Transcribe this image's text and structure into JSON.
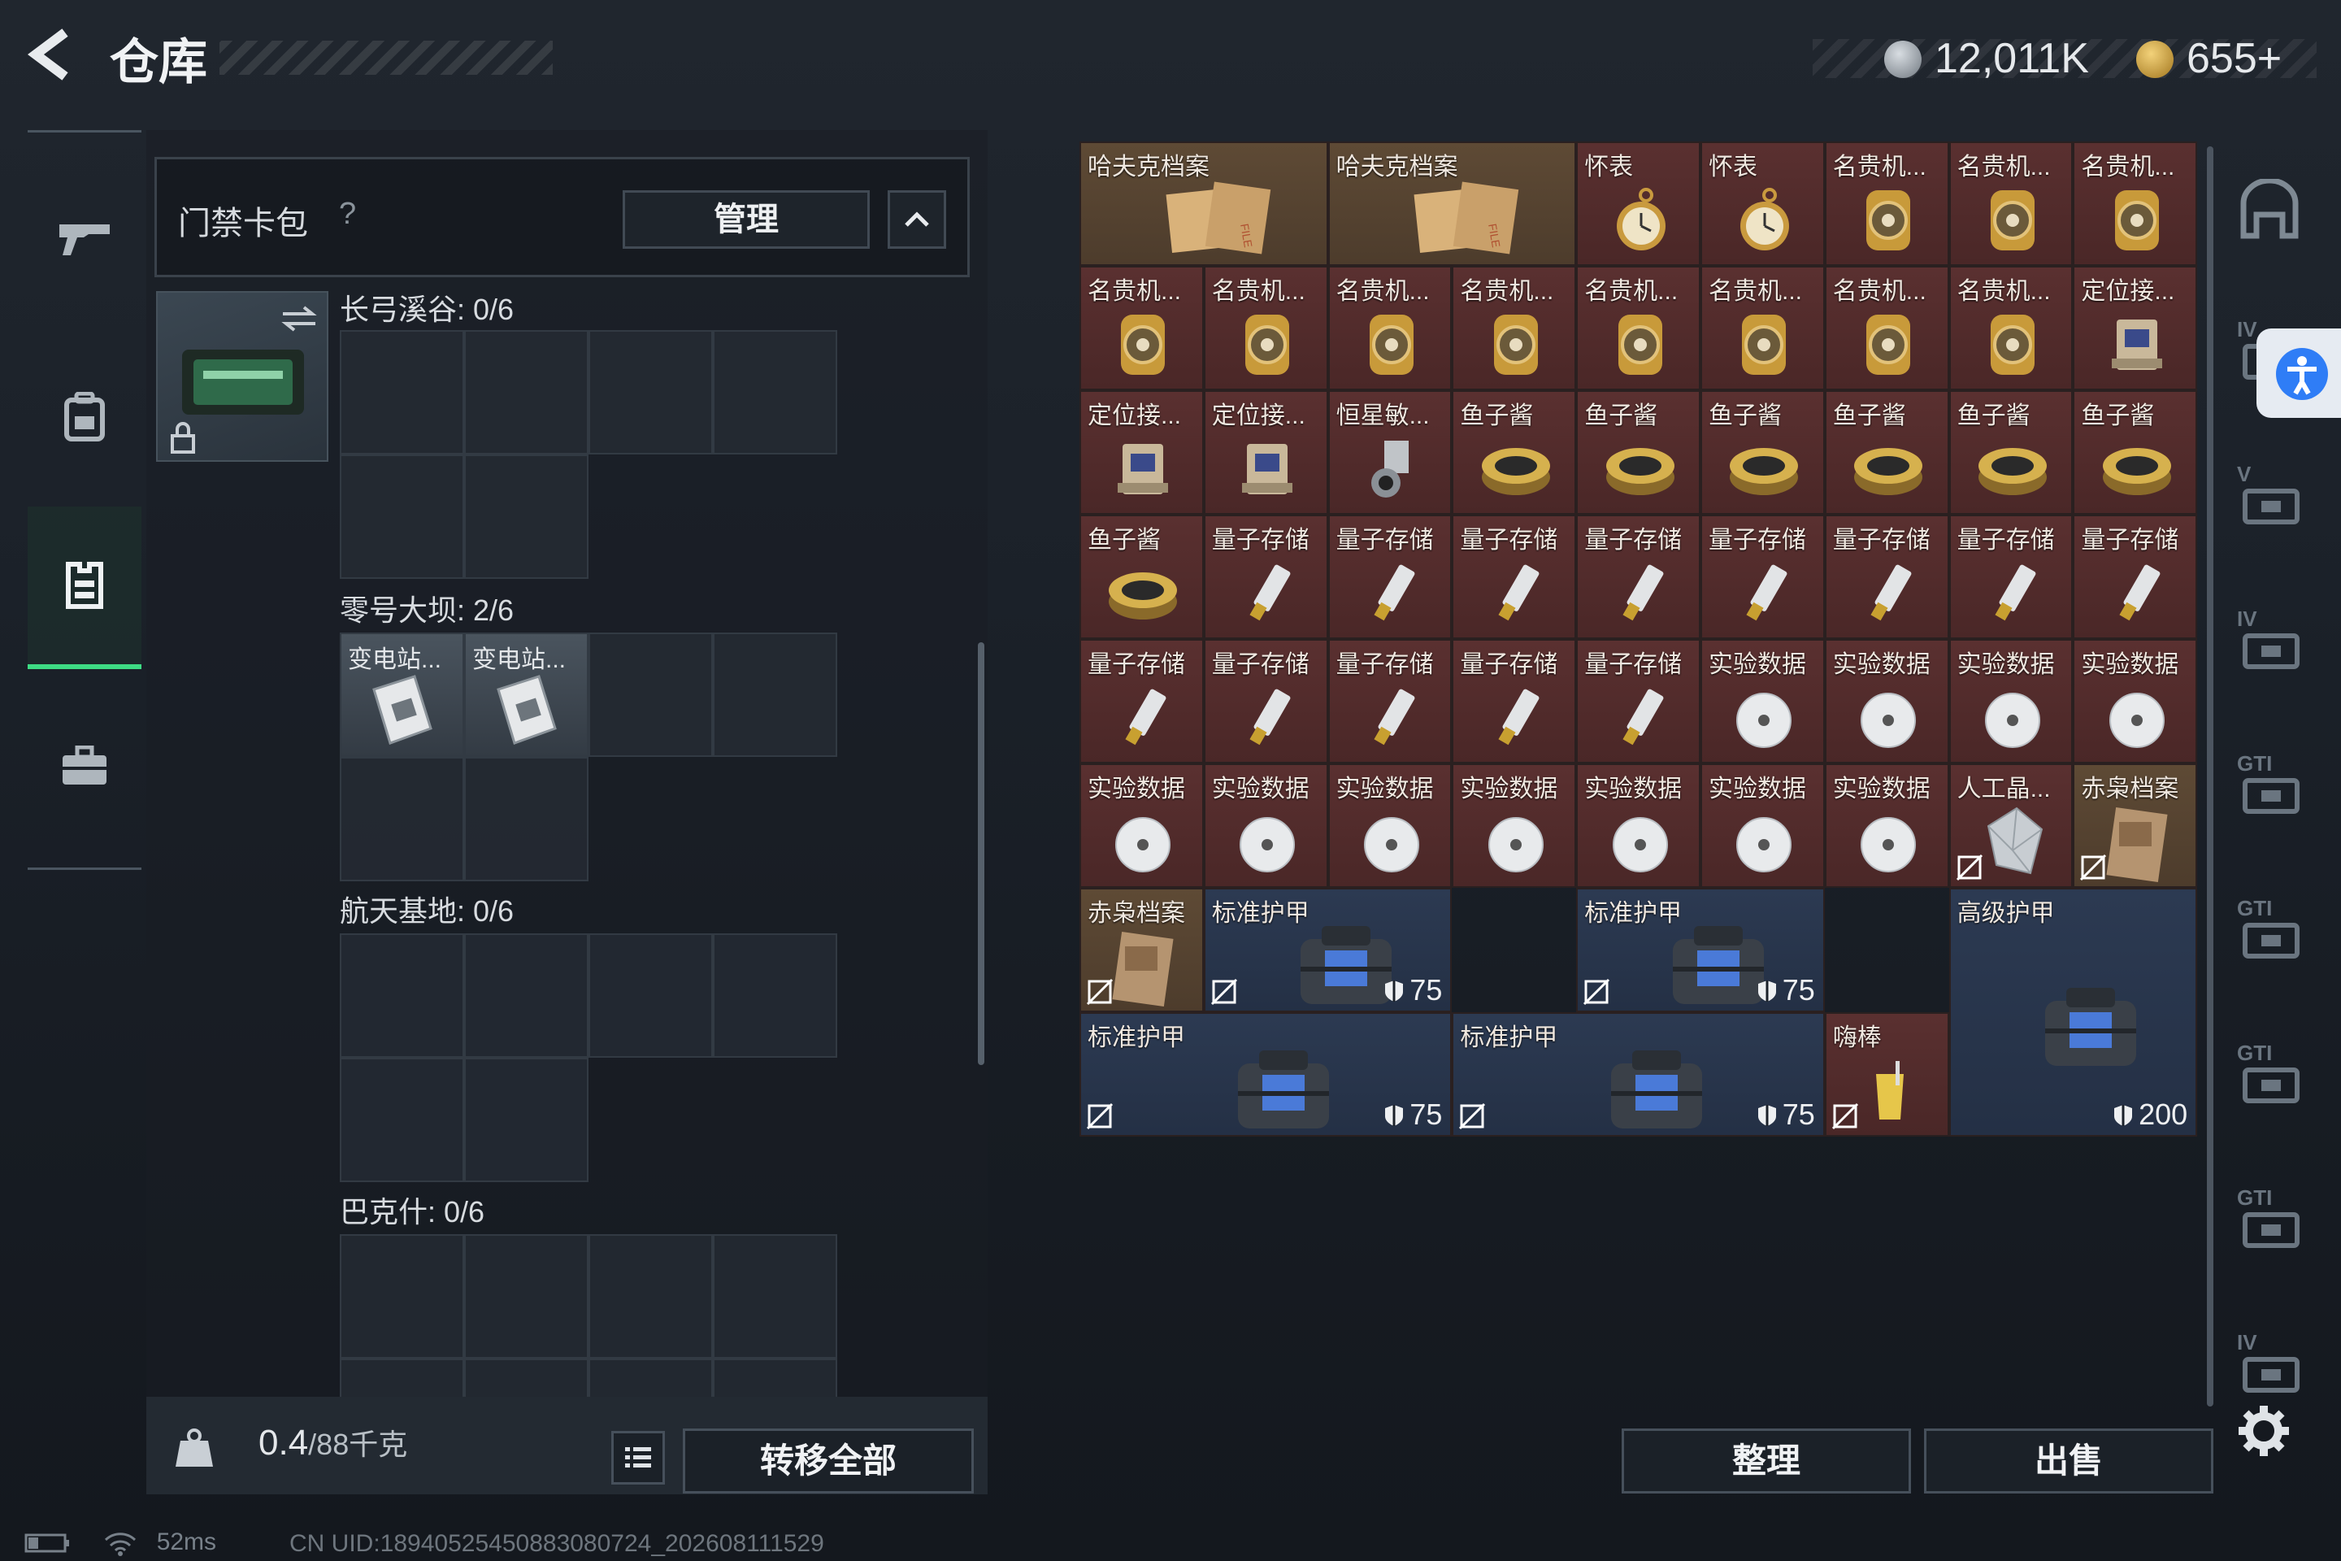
{
  "header": {
    "back_icon": "back-arrow-icon",
    "title": "仓库",
    "currency_silver": "12,011K",
    "currency_gold": "655+"
  },
  "left_nav": {
    "items": [
      {
        "icon": "gun-icon"
      },
      {
        "icon": "backpack-icon"
      },
      {
        "icon": "vest-icon",
        "active": true
      },
      {
        "icon": "case-icon"
      }
    ]
  },
  "card_pack": {
    "title": "门禁卡包",
    "help": "?",
    "manage_label": "管理",
    "sections": [
      {
        "label": "长弓溪谷: 0/6",
        "items": []
      },
      {
        "label": "零号大坝: 2/6",
        "items": [
          "变电站...",
          "变电站..."
        ]
      },
      {
        "label": "航天基地: 0/6",
        "items": []
      },
      {
        "label": "巴克什: 0/6",
        "items": []
      }
    ]
  },
  "footer": {
    "weight_value": "0.4",
    "weight_total": "/88千克",
    "transfer_label": "转移全部",
    "sort_label": "整理",
    "sell_label": "出售"
  },
  "grid_items": [
    {
      "name": "哈夫克档案",
      "kind": "file",
      "tone": "gold"
    },
    {
      "name": "哈夫克档案",
      "kind": "file",
      "tone": "gold"
    },
    {
      "name": "怀表",
      "kind": "pocketwatch",
      "tone": "red"
    },
    {
      "name": "怀表",
      "kind": "pocketwatch",
      "tone": "red"
    },
    {
      "name": "名贵机...",
      "kind": "watch",
      "tone": "red"
    },
    {
      "name": "名贵机...",
      "kind": "watch",
      "tone": "red"
    },
    {
      "name": "名贵机...",
      "kind": "watch",
      "tone": "red"
    },
    {
      "name": "名贵机...",
      "kind": "watch",
      "tone": "red"
    },
    {
      "name": "名贵机...",
      "kind": "watch",
      "tone": "red"
    },
    {
      "name": "名贵机...",
      "kind": "watch",
      "tone": "red"
    },
    {
      "name": "名贵机...",
      "kind": "watch",
      "tone": "red"
    },
    {
      "name": "名贵机...",
      "kind": "watch",
      "tone": "red"
    },
    {
      "name": "名贵机...",
      "kind": "watch",
      "tone": "red"
    },
    {
      "name": "名贵机...",
      "kind": "watch",
      "tone": "red"
    },
    {
      "name": "名贵机...",
      "kind": "watch",
      "tone": "red"
    },
    {
      "name": "定位接...",
      "kind": "locator",
      "tone": "red"
    },
    {
      "name": "定位接...",
      "kind": "locator",
      "tone": "red"
    },
    {
      "name": "定位接...",
      "kind": "locator",
      "tone": "red"
    },
    {
      "name": "恒星敏...",
      "kind": "sensor",
      "tone": "red"
    },
    {
      "name": "鱼子酱",
      "kind": "caviar",
      "tone": "red"
    },
    {
      "name": "鱼子酱",
      "kind": "caviar",
      "tone": "red"
    },
    {
      "name": "鱼子酱",
      "kind": "caviar",
      "tone": "red"
    },
    {
      "name": "鱼子酱",
      "kind": "caviar",
      "tone": "red"
    },
    {
      "name": "鱼子酱",
      "kind": "caviar",
      "tone": "red"
    },
    {
      "name": "鱼子酱",
      "kind": "caviar",
      "tone": "red"
    },
    {
      "name": "鱼子酱",
      "kind": "caviar",
      "tone": "red"
    },
    {
      "name": "量子存储",
      "kind": "usb",
      "tone": "red"
    },
    {
      "name": "量子存储",
      "kind": "usb",
      "tone": "red"
    },
    {
      "name": "量子存储",
      "kind": "usb",
      "tone": "red"
    },
    {
      "name": "量子存储",
      "kind": "usb",
      "tone": "red"
    },
    {
      "name": "量子存储",
      "kind": "usb",
      "tone": "red"
    },
    {
      "name": "量子存储",
      "kind": "usb",
      "tone": "red"
    },
    {
      "name": "量子存储",
      "kind": "usb",
      "tone": "red"
    },
    {
      "name": "量子存储",
      "kind": "usb",
      "tone": "red"
    },
    {
      "name": "量子存储",
      "kind": "usb",
      "tone": "red"
    },
    {
      "name": "量子存储",
      "kind": "usb",
      "tone": "red"
    },
    {
      "name": "量子存储",
      "kind": "usb",
      "tone": "red"
    },
    {
      "name": "量子存储",
      "kind": "usb",
      "tone": "red"
    },
    {
      "name": "量子存储",
      "kind": "usb",
      "tone": "red"
    },
    {
      "name": "实验数据",
      "kind": "disc",
      "tone": "red"
    },
    {
      "name": "实验数据",
      "kind": "disc",
      "tone": "red"
    },
    {
      "name": "实验数据",
      "kind": "disc",
      "tone": "red"
    },
    {
      "name": "实验数据",
      "kind": "disc",
      "tone": "red"
    },
    {
      "name": "实验数据",
      "kind": "disc",
      "tone": "red"
    },
    {
      "name": "实验数据",
      "kind": "disc",
      "tone": "red"
    },
    {
      "name": "实验数据",
      "kind": "disc",
      "tone": "red"
    },
    {
      "name": "实验数据",
      "kind": "disc",
      "tone": "red"
    },
    {
      "name": "实验数据",
      "kind": "disc",
      "tone": "red"
    },
    {
      "name": "实验数据",
      "kind": "disc",
      "tone": "red"
    },
    {
      "name": "实验数据",
      "kind": "disc",
      "tone": "red"
    },
    {
      "name": "人工晶...",
      "kind": "crystal",
      "tone": "red",
      "locked": true
    },
    {
      "name": "赤枭档案",
      "kind": "dossier",
      "tone": "gold",
      "locked": true
    }
  ],
  "armor_items": [
    {
      "name": "赤枭档案",
      "kind": "dossier",
      "tone": "gold",
      "locked": true
    },
    {
      "name": "标准护甲",
      "value": "75",
      "locked": true
    },
    {
      "name": "标准护甲",
      "value": "75",
      "locked": true
    },
    {
      "name": "高级护甲",
      "value": "200"
    },
    {
      "name": "标准护甲",
      "value": "75",
      "locked": true
    },
    {
      "name": "标准护甲",
      "value": "75",
      "locked": true
    },
    {
      "name": "嗨棒",
      "kind": "drink",
      "tone": "red",
      "locked": true
    }
  ],
  "right_nav": {
    "labels": [
      "IV",
      "V",
      "IV",
      "GTI",
      "GTI",
      "GTI",
      "GTI",
      "IV"
    ]
  },
  "status": {
    "ping": "52ms",
    "uid": "CN UID:18940525450883080724_202608111529"
  }
}
